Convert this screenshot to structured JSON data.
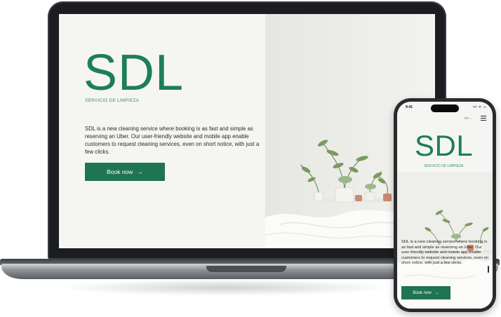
{
  "laptop": {
    "logo": "SDL",
    "subtitle": "SERVICIO DE LIMPIEZA",
    "description": "SDL is a new cleaning service where booking is as fast and simple as reserving an Uber. Our user-friendly website and mobile app enable customers to request cleaning services, even on short notice, with just a few clicks.",
    "cta_label": "Book now",
    "cta_arrow": "→"
  },
  "phone": {
    "status_time": "9:41",
    "status_icons": "•ıl ᯤ ▭",
    "language": "EN",
    "language_chevron": "⌵",
    "logo": "SDL",
    "subtitle": "SERVICIO DE LIMPIEZA",
    "description": "SDL is a new cleaning service where booking is as fast and simple as reserving an Uber. Our user-friendly website and mobile app enable customers to request cleaning services, even on short notice, with just a few clicks.",
    "cta_label": "Book now",
    "cta_arrow": "→"
  },
  "colors": {
    "brand_green": "#1e7d5b",
    "button_green": "#1f7452",
    "page_background": "#f5f6f3"
  },
  "icons": [
    "hamburger-menu-icon",
    "arrow-right-icon",
    "chevron-down-icon",
    "signal-icon",
    "wifi-icon",
    "battery-icon"
  ]
}
